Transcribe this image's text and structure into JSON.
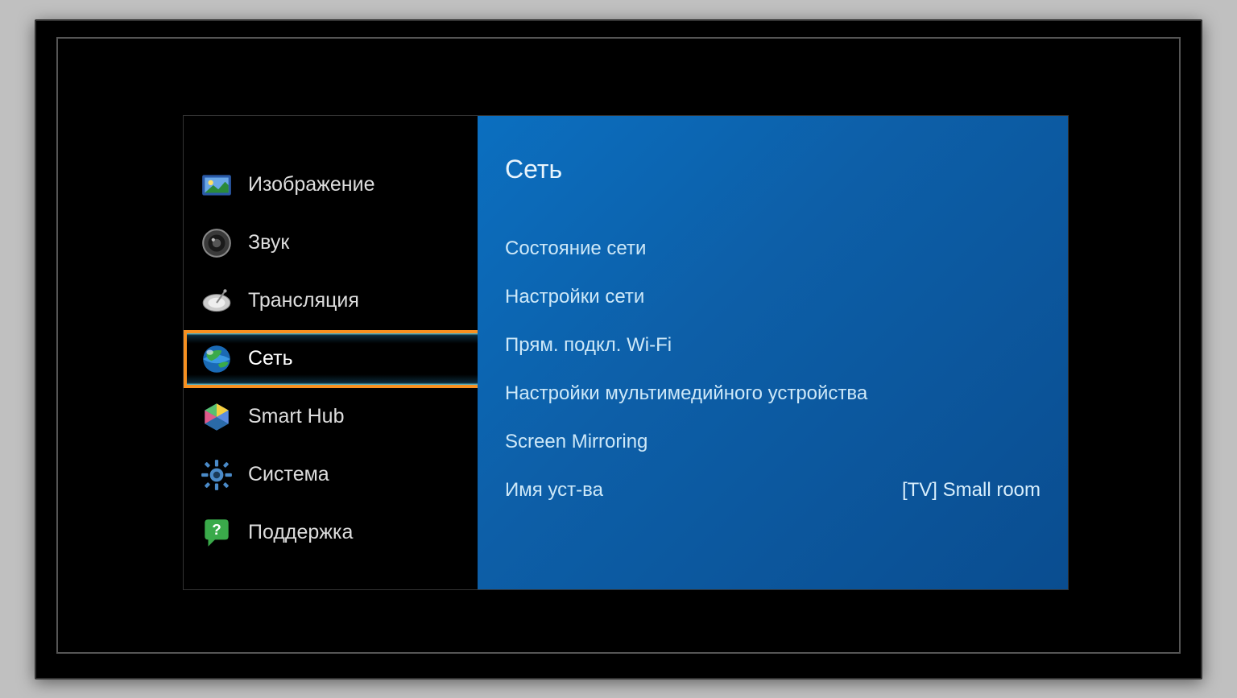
{
  "sidebar": {
    "items": [
      {
        "label": "Изображение",
        "icon": "picture"
      },
      {
        "label": "Звук",
        "icon": "sound"
      },
      {
        "label": "Трансляция",
        "icon": "broadcast"
      },
      {
        "label": "Сеть",
        "icon": "network",
        "selected": true
      },
      {
        "label": "Smart Hub",
        "icon": "smarthub"
      },
      {
        "label": "Система",
        "icon": "system"
      },
      {
        "label": "Поддержка",
        "icon": "support"
      }
    ]
  },
  "panel": {
    "title": "Сеть",
    "items": [
      {
        "label": "Состояние сети"
      },
      {
        "label": "Настройки сети"
      },
      {
        "label": "Прям. подкл. Wi-Fi"
      },
      {
        "label": "Настройки мультимедийного устройства"
      },
      {
        "label": "Screen Mirroring"
      },
      {
        "label": "Имя уст-ва",
        "value": "[TV] Small room"
      }
    ]
  }
}
